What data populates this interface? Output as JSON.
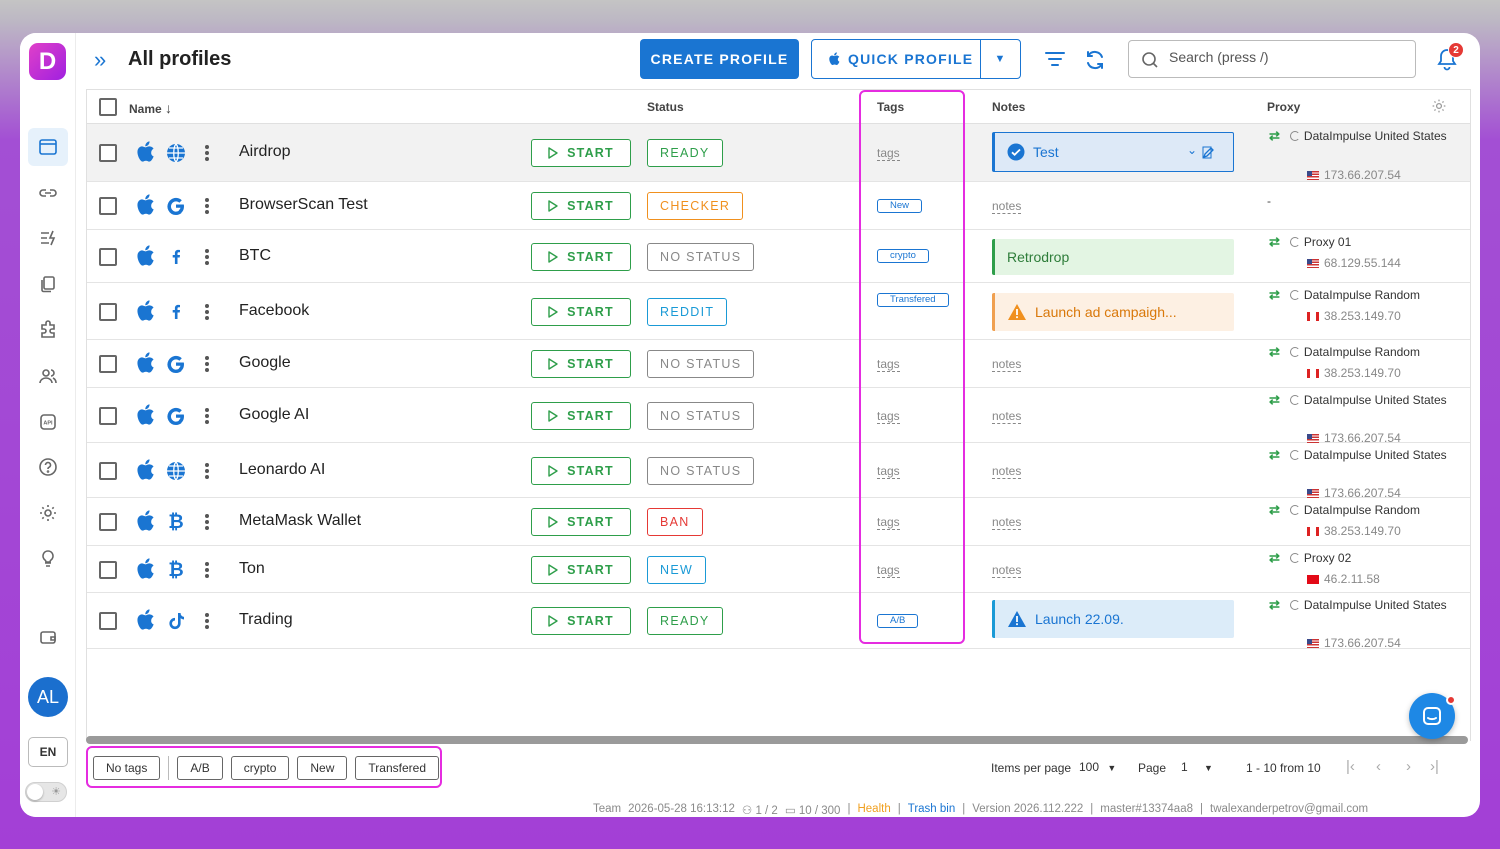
{
  "header": {
    "title": "All profiles",
    "create_label": "CREATE PROFILE",
    "quick_label": "QUICK PROFILE",
    "search_placeholder": "Search (press /)",
    "notifications_count": "2"
  },
  "sidebar": {
    "logo": "D",
    "items": [
      "profiles-icon",
      "link-icon",
      "automation-icon",
      "copy-icon",
      "extensions-icon",
      "team-icon",
      "api-icon",
      "help-icon",
      "settings-icon",
      "idea-icon",
      "wallet-icon"
    ],
    "avatar": "AL",
    "lang": "EN"
  },
  "table": {
    "columns": {
      "name": "Name",
      "status": "Status",
      "tags": "Tags",
      "notes": "Notes",
      "proxy": "Proxy"
    },
    "start_label": "START",
    "tags_placeholder": "tags",
    "notes_placeholder": "notes",
    "rows": [
      {
        "name": "Airdrop",
        "site": "globe",
        "status": "READY",
        "tag": "",
        "note": "Test",
        "proxy_name": "DataImpulse United States",
        "proxy_ip": "173.66.207.54",
        "flag": "us"
      },
      {
        "name": "BrowserScan Test",
        "site": "google",
        "status": "CHECKER",
        "tag": "New",
        "note": "",
        "proxy_name": "-",
        "proxy_ip": "",
        "flag": ""
      },
      {
        "name": "BTC",
        "site": "facebook",
        "status": "NO STATUS",
        "tag": "crypto",
        "note": "Retrodrop",
        "proxy_name": "Proxy 01",
        "proxy_ip": "68.129.55.144",
        "flag": "us"
      },
      {
        "name": "Facebook",
        "site": "facebook",
        "status": "REDDIT",
        "tag": "Transfered",
        "note": "Launch ad campaigh...",
        "proxy_name": "DataImpulse Random",
        "proxy_ip": "38.253.149.70",
        "flag": "ca"
      },
      {
        "name": "Google",
        "site": "google",
        "status": "NO STATUS",
        "tag": "",
        "note": "",
        "proxy_name": "DataImpulse Random",
        "proxy_ip": "38.253.149.70",
        "flag": "ca"
      },
      {
        "name": "Google AI",
        "site": "google",
        "status": "NO STATUS",
        "tag": "",
        "note": "",
        "proxy_name": "DataImpulse United States",
        "proxy_ip": "173.66.207.54",
        "flag": "us"
      },
      {
        "name": "Leonardo AI",
        "site": "globe",
        "status": "NO STATUS",
        "tag": "",
        "note": "",
        "proxy_name": "DataImpulse United States",
        "proxy_ip": "173.66.207.54",
        "flag": "us"
      },
      {
        "name": "MetaMask Wallet",
        "site": "bitcoin",
        "status": "BAN",
        "tag": "",
        "note": "",
        "proxy_name": "DataImpulse Random",
        "proxy_ip": "38.253.149.70",
        "flag": "ca"
      },
      {
        "name": "Ton",
        "site": "bitcoin",
        "status": "NEW",
        "tag": "",
        "note": "",
        "proxy_name": "Proxy 02",
        "proxy_ip": "46.2.11.58",
        "flag": "tr"
      },
      {
        "name": "Trading",
        "site": "tiktok",
        "status": "READY",
        "tag": "A/B",
        "note": "Launch 22.09.",
        "proxy_name": "DataImpulse United States",
        "proxy_ip": "173.66.207.54",
        "flag": "us"
      }
    ]
  },
  "tag_filters": [
    "No tags",
    "A/B",
    "crypto",
    "New",
    "Transfered"
  ],
  "pagination": {
    "items_per_page_label": "Items per page",
    "items_per_page": "100",
    "page_label": "Page",
    "page": "1",
    "range": "1 - 10 from 10"
  },
  "footer": {
    "team": "Team",
    "datetime": "2026-05-28 16:13:12",
    "members": "1 / 2",
    "profiles": "10 / 300",
    "health": "Health",
    "trash": "Trash bin",
    "version": "Version 2026.112.222",
    "branch": "master#13374aa8",
    "email": "twalexanderpetrov@gmail.com"
  },
  "colors": {
    "accent": "#1a75d2",
    "start_green": "#2e9e4a",
    "ready": "#2e9e4a",
    "checker": "#f0901e",
    "no_status": "#888888",
    "reddit": "#1a9ad6",
    "ban": "#e53935",
    "new": "#1a9ad6",
    "highlight": "#e52ce0"
  }
}
